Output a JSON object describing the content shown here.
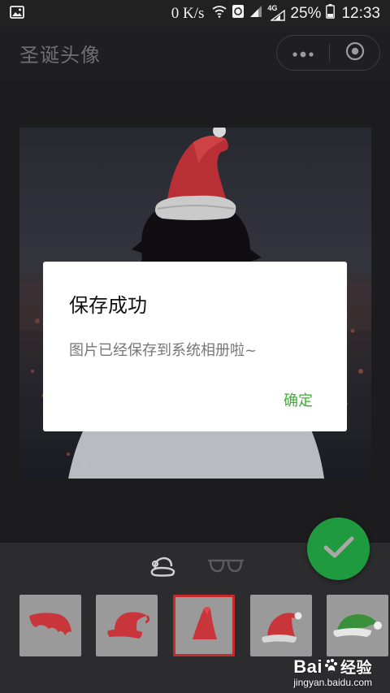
{
  "status_bar": {
    "network_speed": "0 K/s",
    "network_type": "4G",
    "battery_percent": "25%",
    "time": "12:33",
    "icons": [
      "gallery-notification-icon",
      "wifi-icon",
      "data-sync-icon",
      "signal-icon",
      "signal-4g-icon",
      "battery-icon"
    ]
  },
  "app_bar": {
    "title": "圣诞头像",
    "more_icon": "more-dots-icon",
    "close_icon": "target-circle-icon"
  },
  "dialog": {
    "title": "保存成功",
    "message": "图片已经保存到系统相册啦~",
    "confirm_label": "确定",
    "confirm_color": "#3cb034"
  },
  "category_tabs": [
    {
      "name": "hat-category-icon",
      "active": true
    },
    {
      "name": "glasses-category-icon",
      "active": false
    }
  ],
  "hat_options": [
    {
      "name": "red-flat-hat",
      "selected": false
    },
    {
      "name": "red-curled-hat",
      "selected": false
    },
    {
      "name": "red-cone-hat",
      "selected": true
    },
    {
      "name": "red-floppy-hat",
      "selected": false
    },
    {
      "name": "green-hat",
      "selected": false
    }
  ],
  "confirm_fab": {
    "icon": "checkmark-icon",
    "color": "#1f9a3e"
  },
  "watermark": {
    "logo_text": "Bai",
    "logo_suffix": "经验",
    "url": "jingyan.baidu.com"
  },
  "colors": {
    "background": "#1f1f21",
    "panel": "#2c2c2e",
    "selected_border": "#c62b2b",
    "hat_red": "#c8353a"
  }
}
